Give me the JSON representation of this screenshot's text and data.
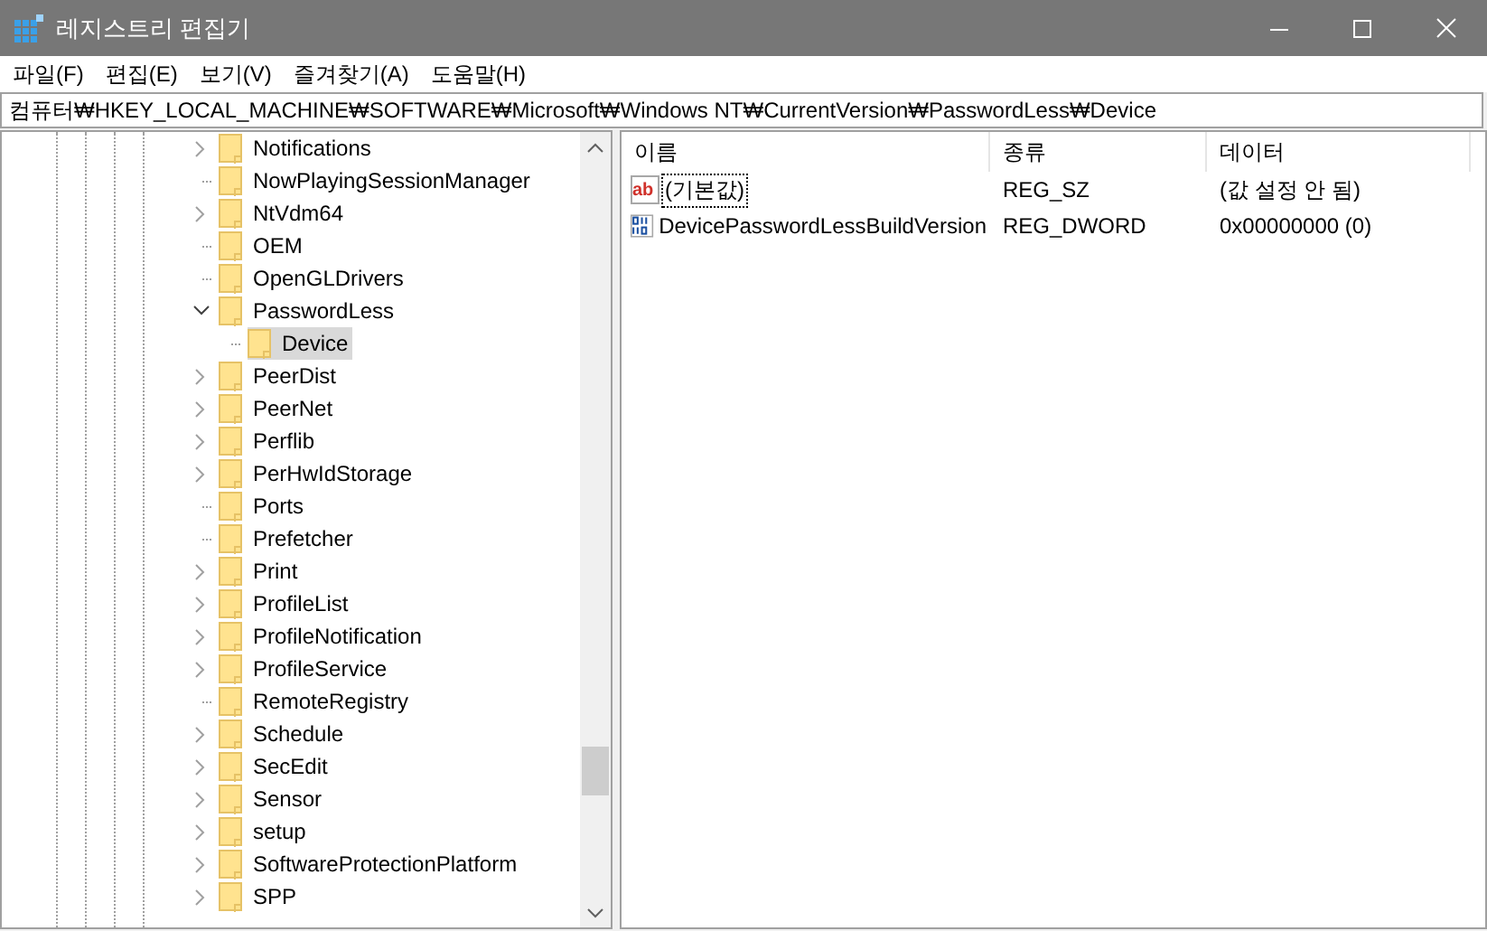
{
  "window": {
    "title": "레지스트리 편집기"
  },
  "menu": [
    "파일(F)",
    "편집(E)",
    "보기(V)",
    "즐겨찾기(A)",
    "도움말(H)"
  ],
  "address": {
    "value": "컴퓨터₩HKEY_LOCAL_MACHINE₩SOFTWARE₩Microsoft₩Windows NT₩CurrentVersion₩PasswordLess₩Device"
  },
  "tree": {
    "items": [
      {
        "label": "Notifications",
        "expanded": false,
        "selected": false
      },
      {
        "label": "NowPlayingSessionManager",
        "selected": false
      },
      {
        "label": "NtVdm64",
        "expanded": false,
        "selected": false
      },
      {
        "label": "OEM",
        "selected": false
      },
      {
        "label": "OpenGLDrivers",
        "selected": false
      },
      {
        "label": "PasswordLess",
        "expanded": true,
        "selected": false,
        "children": [
          {
            "label": "Device",
            "selected": true
          }
        ]
      },
      {
        "label": "PeerDist",
        "expanded": false,
        "selected": false
      },
      {
        "label": "PeerNet",
        "expanded": false,
        "selected": false
      },
      {
        "label": "Perflib",
        "expanded": false,
        "selected": false
      },
      {
        "label": "PerHwIdStorage",
        "expanded": false,
        "selected": false
      },
      {
        "label": "Ports",
        "selected": false
      },
      {
        "label": "Prefetcher",
        "selected": false
      },
      {
        "label": "Print",
        "expanded": false,
        "selected": false
      },
      {
        "label": "ProfileList",
        "expanded": false,
        "selected": false
      },
      {
        "label": "ProfileNotification",
        "expanded": false,
        "selected": false
      },
      {
        "label": "ProfileService",
        "expanded": false,
        "selected": false
      },
      {
        "label": "RemoteRegistry",
        "selected": false
      },
      {
        "label": "Schedule",
        "expanded": false,
        "selected": false
      },
      {
        "label": "SecEdit",
        "expanded": false,
        "selected": false
      },
      {
        "label": "Sensor",
        "expanded": false,
        "selected": false
      },
      {
        "label": "setup",
        "expanded": false,
        "selected": false
      },
      {
        "label": "SoftwareProtectionPlatform",
        "expanded": false,
        "selected": false
      },
      {
        "label": "SPP",
        "expanded": false,
        "selected": false
      }
    ]
  },
  "values": {
    "columns": [
      "이름",
      "종류",
      "데이터"
    ],
    "rows": [
      {
        "kind": "string",
        "icon_text": "ab",
        "name": "(기본값)",
        "type": "REG_SZ",
        "data": "(값 설정 안 됨)",
        "focused": true,
        "selected": false
      },
      {
        "kind": "binary",
        "name": "DevicePasswordLessBuildVersion",
        "type": "REG_DWORD",
        "data": "0x00000000 (0)",
        "focused": false,
        "selected": false
      }
    ]
  }
}
